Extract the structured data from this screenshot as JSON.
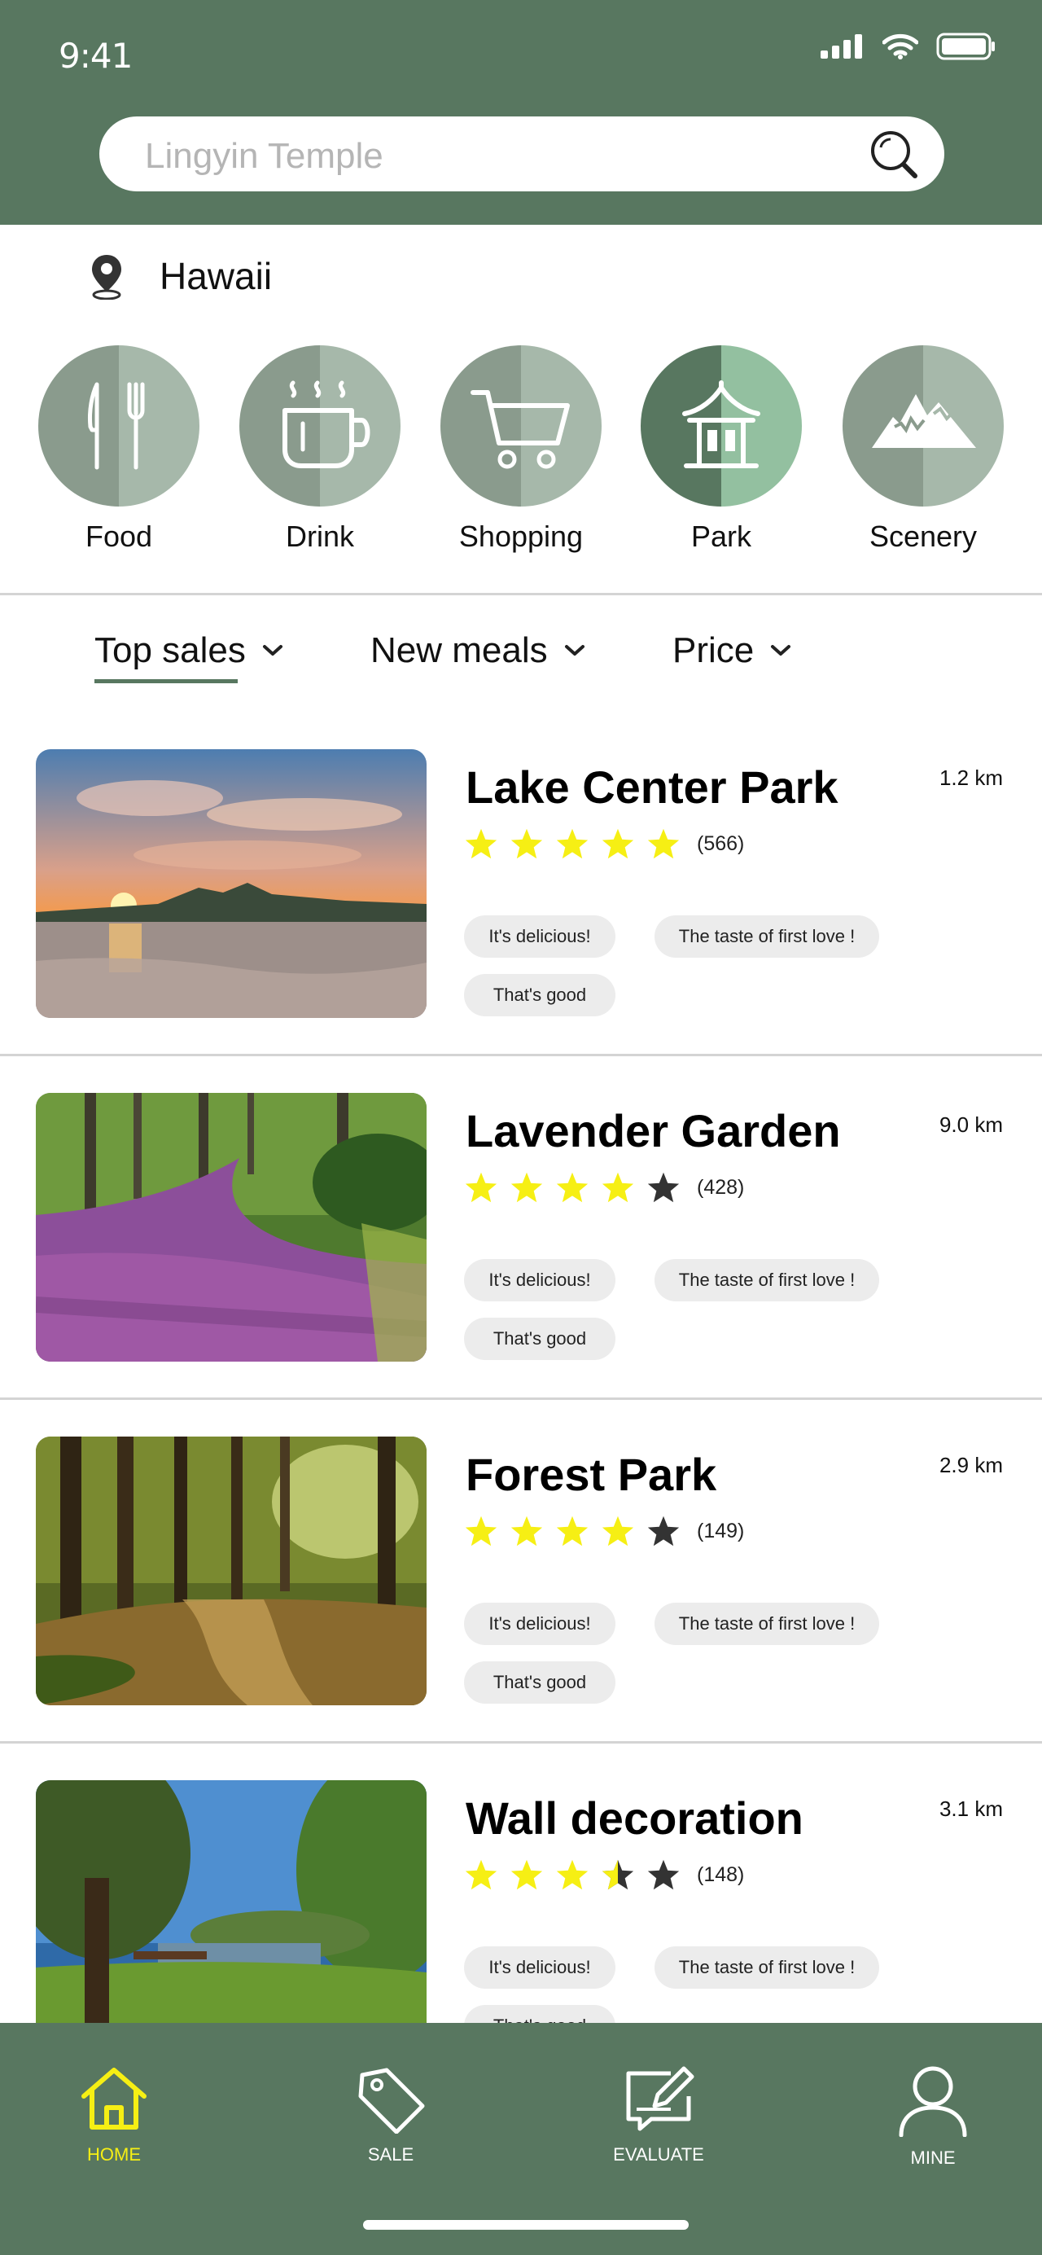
{
  "status_bar": {
    "time": "9:41"
  },
  "search": {
    "placeholder": "Lingyin Temple"
  },
  "location": {
    "name": "Hawaii"
  },
  "categories": [
    {
      "label": "Food",
      "icon": "fork-knife-icon"
    },
    {
      "label": "Drink",
      "icon": "coffee-cup-icon"
    },
    {
      "label": "Shopping",
      "icon": "shopping-cart-icon"
    },
    {
      "label": "Park",
      "icon": "pavilion-icon",
      "selected": true
    },
    {
      "label": "Scenery",
      "icon": "mountain-icon"
    }
  ],
  "sort_tabs": [
    {
      "label": "Top sales",
      "active": true
    },
    {
      "label": "New meals"
    },
    {
      "label": "Price"
    }
  ],
  "places": [
    {
      "title": "Lake Center Park",
      "distance": "1.2 km",
      "rating": 5,
      "reviews": "(566)",
      "tags": [
        "It's delicious!",
        "The taste of first love !",
        "That's good"
      ]
    },
    {
      "title": "Lavender Garden",
      "distance": "9.0 km",
      "rating": 4,
      "reviews": "(428)",
      "tags": [
        "It's delicious!",
        "The taste of first love !",
        "That's good"
      ]
    },
    {
      "title": "Forest Park",
      "distance": "2.9 km",
      "rating": 4,
      "reviews": "(149)",
      "tags": [
        "It's delicious!",
        "The taste of first love !",
        "That's good"
      ]
    },
    {
      "title": "Wall decoration",
      "distance": "3.1 km",
      "rating": 3.5,
      "reviews": "(148)",
      "tags": [
        "It's delicious!",
        "The taste of first love !",
        "That's good"
      ]
    }
  ],
  "bottom_nav": [
    {
      "label": "HOME",
      "icon": "home-icon",
      "active": true
    },
    {
      "label": "SALE",
      "icon": "price-tag-icon"
    },
    {
      "label": "EVALUATE",
      "icon": "edit-note-icon"
    },
    {
      "label": "MINE",
      "icon": "user-icon"
    }
  ],
  "colors": {
    "brand_green": "#587760",
    "star_yellow": "#f6ef14",
    "star_empty": "#333333",
    "tag_bg": "#ececec"
  }
}
